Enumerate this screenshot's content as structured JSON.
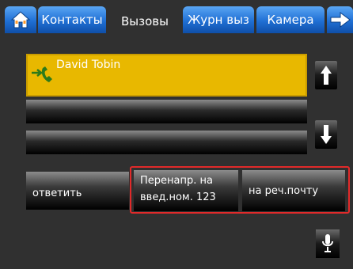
{
  "tabs": {
    "home_icon": "home-icon",
    "items": [
      {
        "label": "Контакты",
        "active": false
      },
      {
        "label": "Вызовы",
        "active": true
      },
      {
        "label": "Журн выз",
        "active": false
      },
      {
        "label": "Камера",
        "active": false
      }
    ],
    "next_icon": "arrow-right-icon"
  },
  "calls": {
    "active_call": {
      "name": "David Tobin",
      "icon": "phone-transfer-icon"
    }
  },
  "scroll": {
    "up_icon": "arrow-up-icon",
    "down_icon": "arrow-down-icon"
  },
  "actions": {
    "answer_label": "ответить",
    "forward_line1": "Перенапр. на",
    "forward_line2": "введ.ном. 123",
    "voicemail_label": "на реч.почту"
  },
  "mic_icon": "microphone-icon",
  "colors": {
    "tab_blue": "#1f6fd4",
    "highlight_yellow": "#e8b800",
    "frame_red": "#e12a2a",
    "background": "#303030"
  }
}
